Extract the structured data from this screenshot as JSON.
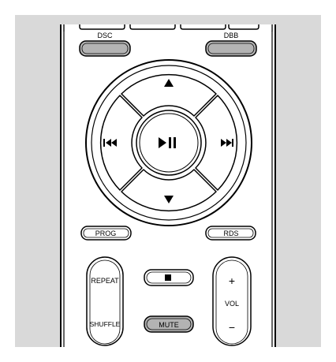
{
  "remote": {
    "top_buttons": {
      "dsc": "DSC",
      "dbb": "DBB"
    },
    "nav": {
      "up": "▲",
      "down": "▼",
      "previous": "◀◀",
      "next": "▶▶",
      "play_pause": "▶II"
    },
    "middle_buttons": {
      "prog": "PROG",
      "rds": "RDS"
    },
    "repeat_shuffle": {
      "repeat": "REPEAT",
      "shuffle": "SHUFFLE"
    },
    "stop": "■",
    "mute": "MUTE",
    "volume": {
      "plus": "+",
      "label": "VOL",
      "minus": "−"
    }
  },
  "colors": {
    "background_panel": "#d9d9d9",
    "remote_body": "#ffffff",
    "highlighted_button": "#b3b3b3",
    "outline": "#000000"
  }
}
